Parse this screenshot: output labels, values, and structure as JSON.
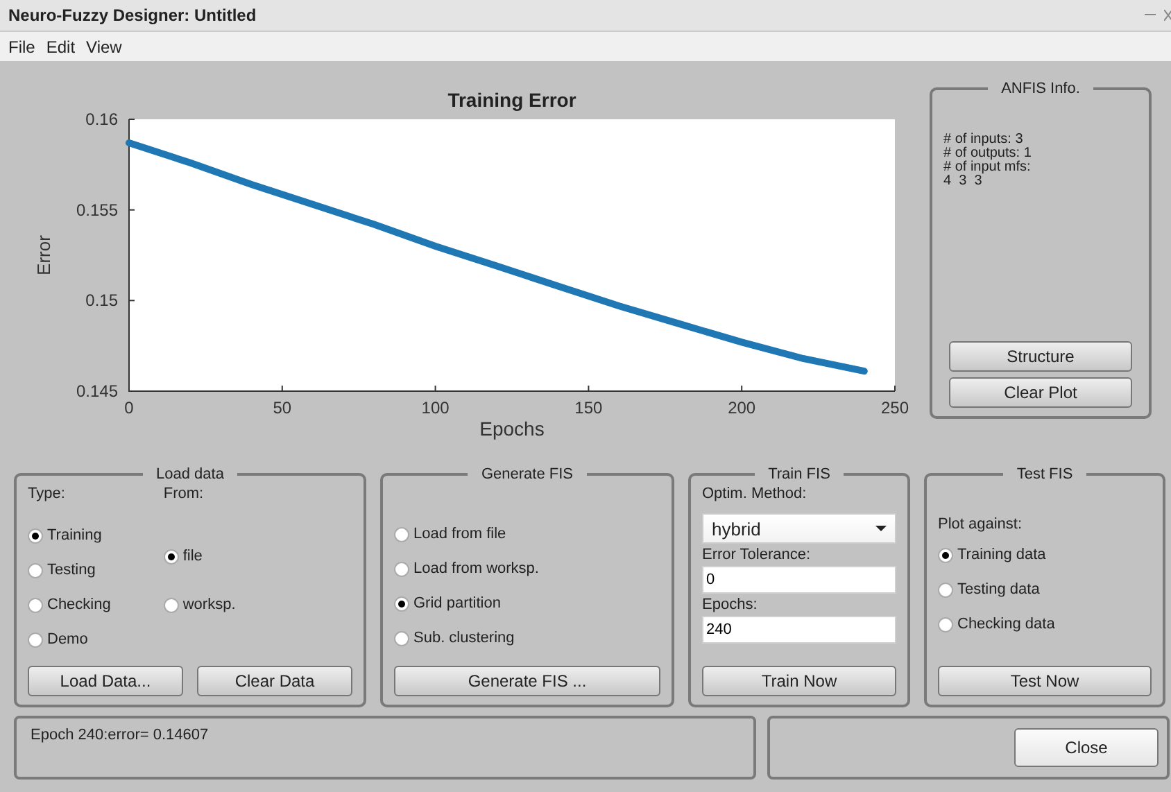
{
  "window": {
    "title": "Neuro-Fuzzy Designer: Untitled"
  },
  "menu": [
    "File",
    "Edit",
    "View"
  ],
  "plot": {
    "chart_data": {
      "type": "line",
      "title": "Training Error",
      "xlabel": "Epochs",
      "ylabel": "Error",
      "x": [
        0,
        20,
        40,
        60,
        80,
        100,
        120,
        140,
        160,
        180,
        200,
        220,
        240
      ],
      "series": [
        {
          "color": "#1f77b4",
          "values": [
            0.1587,
            0.1576,
            0.1564,
            0.1553,
            0.1542,
            0.153,
            0.1519,
            0.1508,
            0.1497,
            0.1487,
            0.1477,
            0.1468,
            0.1461
          ]
        }
      ],
      "xlim": [
        0,
        250
      ],
      "ylim": [
        0.145,
        0.16
      ],
      "xticks": [
        0,
        50,
        100,
        150,
        200,
        250
      ],
      "yticks": [
        0.145,
        0.15,
        0.155,
        0.16
      ]
    }
  },
  "anfis_info": {
    "title": "ANFIS Info.",
    "lines": [
      "# of inputs: 3",
      "# of outputs: 1",
      "# of input mfs:",
      "4  3  3"
    ],
    "buttons": [
      "Structure",
      "Clear Plot"
    ]
  },
  "load_data": {
    "title": "Load data",
    "type_label": "Type:",
    "from_label": "From:",
    "type_options": [
      {
        "label": "Training",
        "selected": true
      },
      {
        "label": "Testing",
        "selected": false
      },
      {
        "label": "Checking",
        "selected": false
      },
      {
        "label": "Demo",
        "selected": false
      }
    ],
    "from_options": [
      {
        "label": "file",
        "selected": true
      },
      {
        "label": "worksp.",
        "selected": false
      }
    ],
    "buttons": [
      "Load Data...",
      "Clear Data"
    ]
  },
  "generate_fis": {
    "title": "Generate FIS",
    "options": [
      {
        "label": "Load from file",
        "selected": false
      },
      {
        "label": "Load from worksp.",
        "selected": false
      },
      {
        "label": "Grid partition",
        "selected": true
      },
      {
        "label": "Sub. clustering",
        "selected": false
      }
    ],
    "button": "Generate FIS ..."
  },
  "train_fis": {
    "title": "Train FIS",
    "method_label": "Optim. Method:",
    "method": "hybrid",
    "tolerance_label": "Error Tolerance:",
    "tolerance": "0",
    "epochs_label": "Epochs:",
    "epochs": "240",
    "button": "Train Now"
  },
  "test_fis": {
    "title": "Test FIS",
    "plot_label": "Plot against:",
    "options": [
      {
        "label": "Training data",
        "selected": true
      },
      {
        "label": "Testing data",
        "selected": false
      },
      {
        "label": "Checking data",
        "selected": false
      }
    ],
    "button": "Test Now"
  },
  "status": {
    "message": "Epoch 240:error= 0.14607",
    "close_button": "Close"
  }
}
